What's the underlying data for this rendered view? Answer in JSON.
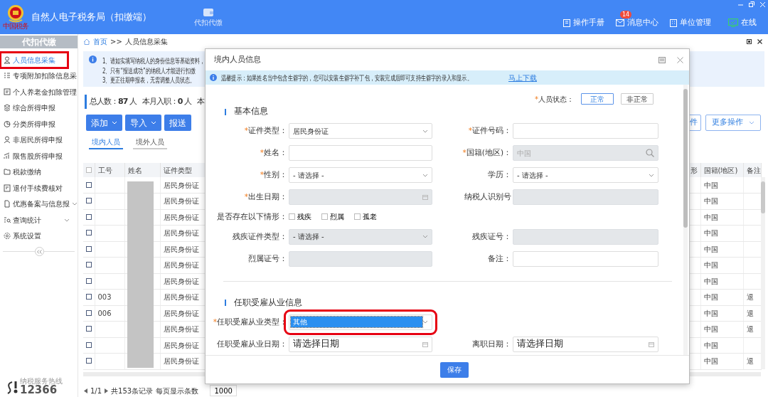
{
  "header": {
    "logo_text": "中国税务",
    "title": "自然人电子税务局（扣缴端）",
    "module": "代扣代缴",
    "links": [
      {
        "kind": "manual",
        "label": "操作手册"
      },
      {
        "kind": "messages",
        "label": "消息中心",
        "badge": "14"
      },
      {
        "kind": "org",
        "label": "单位管理"
      },
      {
        "kind": "online",
        "label": "在线"
      }
    ]
  },
  "sidebar": {
    "title": "代扣代缴",
    "items": [
      {
        "label": "人员信息采集",
        "selected": true,
        "annotated": true,
        "expandable": false
      },
      {
        "label": "专项附加扣除信息采",
        "selected": false,
        "annotated": false,
        "expandable": false
      },
      {
        "label": "个人养老金扣除管理",
        "selected": false,
        "annotated": false,
        "expandable": false
      },
      {
        "label": "综合所得申报",
        "selected": false,
        "annotated": false,
        "expandable": false
      },
      {
        "label": "分类所得申报",
        "selected": false,
        "annotated": false,
        "expandable": false
      },
      {
        "label": "非居民所得申报",
        "selected": false,
        "annotated": false,
        "expandable": false
      },
      {
        "label": "限售股所得申报",
        "selected": false,
        "annotated": false,
        "expandable": false
      },
      {
        "label": "税款缴纳",
        "selected": false,
        "annotated": false,
        "expandable": false
      },
      {
        "label": "退付手续费核对",
        "selected": false,
        "annotated": false,
        "expandable": false
      },
      {
        "label": "优惠备案与信息报",
        "selected": false,
        "annotated": false,
        "expandable": true
      },
      {
        "label": "查询统计",
        "selected": false,
        "annotated": false,
        "expandable": true
      },
      {
        "label": "系统设置",
        "selected": false,
        "annotated": false,
        "expandable": false
      }
    ],
    "hotline_caption": "纳税服务热线",
    "hotline": "12366"
  },
  "breadcrumb": {
    "items": [
      "首页",
      "人员信息采集"
    ],
    "separator": ">>"
  },
  "notices": [
    "1、请如实填写纳税人的身份信息等基础资料，",
    "2、只有“报送成功”的纳税人才能进行扣缴",
    "3、更正往期申报表，无需调整人员状态。"
  ],
  "stats": [
    "总人数：**87** 人",
    "本月入职：**0** 人",
    "本"
  ],
  "actions": [
    {
      "label": "添加",
      "dropdown": true
    },
    {
      "label": "导入",
      "dropdown": true
    },
    {
      "label": "报送",
      "dropdown": false
    }
  ],
  "right_actions": [
    {
      "label": "件",
      "dropdown": false
    },
    {
      "label": "更多操作",
      "dropdown": true
    }
  ],
  "tabs": [
    {
      "label": "境内人员",
      "selected": true
    },
    {
      "label": "境外人员",
      "selected": false
    }
  ],
  "table": {
    "columns": [
      "工号",
      "姓名",
      "证件类型",
      "形",
      "国籍(地区)",
      "备注"
    ],
    "all_checked": false,
    "names_redacted": true,
    "rows": [
      {
        "checked": false,
        "id": "",
        "id_type": "居民身份证",
        "nationality": "中国",
        "note": ""
      },
      {
        "checked": false,
        "id": "",
        "id_type": "居民身份证",
        "nationality": "中国",
        "note": ""
      },
      {
        "checked": false,
        "id": "",
        "id_type": "居民身份证",
        "nationality": "中国",
        "note": ""
      },
      {
        "checked": false,
        "id": "",
        "id_type": "居民身份证",
        "nationality": "中国",
        "note": ""
      },
      {
        "checked": false,
        "id": "",
        "id_type": "居民身份证",
        "nationality": "中国",
        "note": ""
      },
      {
        "checked": false,
        "id": "",
        "id_type": "居民身份证",
        "nationality": "中国",
        "note": ""
      },
      {
        "checked": false,
        "id": "",
        "id_type": "居民身份证",
        "nationality": "中国",
        "note": ""
      },
      {
        "checked": false,
        "id": "003",
        "id_type": "居民身份证",
        "nationality": "中国",
        "note": "退"
      },
      {
        "checked": false,
        "id": "006",
        "id_type": "居民身份证",
        "nationality": "中国",
        "note": "退"
      },
      {
        "checked": false,
        "id": "",
        "id_type": "居民身份证",
        "nationality": "中国",
        "note": "退"
      },
      {
        "checked": false,
        "id": "",
        "id_type": "居民身份证",
        "nationality": "中国",
        "note": ""
      },
      {
        "checked": false,
        "id": "",
        "id_type": "居民身份证",
        "nationality": "中国",
        "note": "退"
      }
    ]
  },
  "pagination": {
    "page": "1/1",
    "total": "共153条记录",
    "per_page_label": "每页显示条数",
    "per_page": "1000"
  },
  "dialog": {
    "title": "境内人员信息",
    "tip_label": "温馨提示：",
    "tip": "如果姓名当中包含生僻字的，您可以安装生僻字补丁包，安装完成后即可支持生僻字的录入和显示。",
    "tip_link": "马上下载",
    "status": {
      "mark": "*",
      "label": "人员状态：",
      "options": [
        {
          "label": "正常",
          "selected": true
        },
        {
          "label": "非正常",
          "selected": false
        }
      ]
    },
    "sections": [
      {
        "title": "基本信息",
        "rows": [
          [
            {
              "kind": "select",
              "mark": "*",
              "label": "证件类型：",
              "value": "居民身份证",
              "disabled": false
            },
            {
              "kind": "input",
              "mark": "*",
              "label": "证件号码：",
              "disabled": false
            }
          ],
          [
            {
              "kind": "input",
              "mark": "*",
              "label": "姓名：",
              "disabled": false
            },
            {
              "kind": "search",
              "mark": "*",
              "label": "国籍(地区)：",
              "placeholder": "中国",
              "disabled": true
            }
          ],
          [
            {
              "kind": "select",
              "mark": "*",
              "label": "性别：",
              "value": "- 请选择 -",
              "disabled": false
            },
            {
              "kind": "select",
              "label": "学历：",
              "value": "- 请选择 -",
              "disabled": false
            }
          ],
          [
            {
              "kind": "date",
              "mark": "*",
              "label": "出生日期：",
              "disabled": true
            },
            {
              "kind": "input",
              "label": "纳税人识别号",
              "disabled": true
            }
          ],
          [
            {
              "kind": "checks",
              "label": "是否存在以下情形：",
              "options": [
                {
                  "label": "残疾",
                  "checked": false
                },
                {
                  "label": "烈属",
                  "checked": false
                },
                {
                  "label": "孤老",
                  "checked": false
                }
              ]
            }
          ],
          [
            {
              "kind": "select",
              "label": "残疾证件类型：",
              "value": "- 请选择 -",
              "disabled": true
            },
            {
              "kind": "input",
              "label": "残疾证号：",
              "disabled": true
            }
          ],
          [
            {
              "kind": "input",
              "label": "烈属证号：",
              "disabled": true
            },
            {
              "kind": "input",
              "label": "备注：",
              "disabled": false
            }
          ]
        ]
      },
      {
        "title": "任职受雇从业信息",
        "rows": [
          [
            {
              "kind": "select",
              "mark": "*",
              "label": "任职受雇从业类型：",
              "value": "其他",
              "disabled": false,
              "highlighted": true,
              "annotated": true
            }
          ],
          [
            {
              "kind": "date",
              "label": "任职受雇从业日期：",
              "placeholder": "请选择日期",
              "disabled": false
            },
            {
              "kind": "date",
              "label": "离职日期：",
              "placeholder": "请选择日期",
              "disabled": false
            }
          ]
        ]
      }
    ],
    "save": "保存"
  }
}
